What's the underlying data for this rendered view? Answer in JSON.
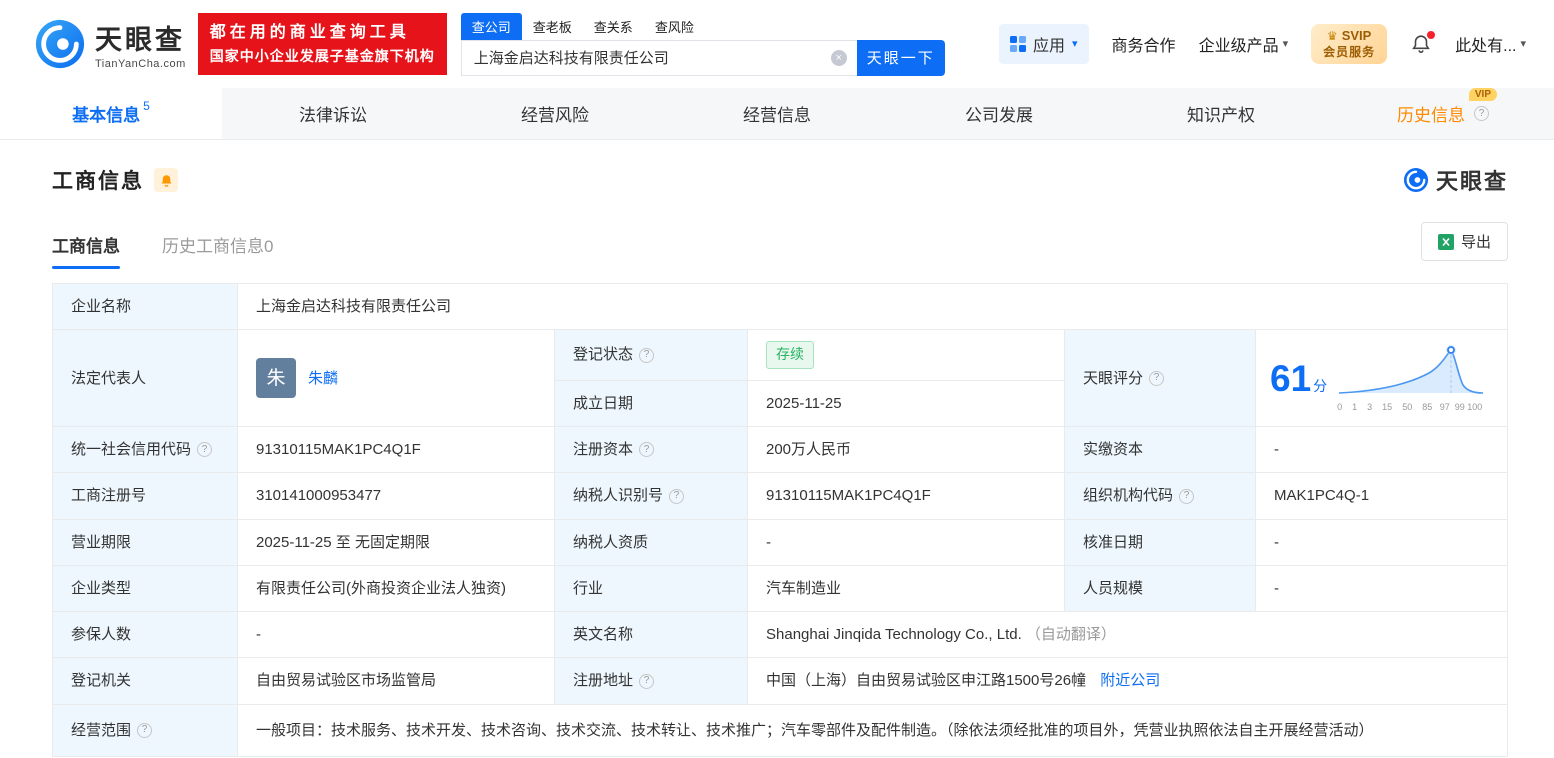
{
  "colors": {
    "accent": "#0d6ef5",
    "brand_red": "#e7131a",
    "status_green": "#28b361",
    "vip_orange": "#ff8a00",
    "label_bg": "#eef7fe"
  },
  "icons": {
    "help": "?",
    "clear": "×",
    "caret_down": "▾",
    "crown": "♛"
  },
  "header": {
    "logo": {
      "name": "天眼查",
      "domain": "TianYanCha.com"
    },
    "promo": {
      "line1": "都在用的商业查询工具",
      "line2": "国家中小企业发展子基金旗下机构"
    },
    "search": {
      "tabs": [
        {
          "label": "查公司"
        },
        {
          "label": "查老板"
        },
        {
          "label": "查关系"
        },
        {
          "label": "查风险"
        }
      ],
      "value": "上海金启达科技有限责任公司",
      "button": "天眼一下"
    },
    "nav": {
      "apps": "应用",
      "cooperation": "商务合作",
      "enterprise": "企业级产品",
      "svip_line1": "SVIP",
      "svip_line2": "会员服务",
      "more": "此处有..."
    }
  },
  "tabs": {
    "items": [
      {
        "label": "基本信息",
        "count": "5"
      },
      {
        "label": "法律诉讼"
      },
      {
        "label": "经营风险"
      },
      {
        "label": "经营信息"
      },
      {
        "label": "公司发展"
      },
      {
        "label": "知识产权"
      },
      {
        "label": "历史信息",
        "vip": "VIP"
      }
    ]
  },
  "section": {
    "title": "工商信息",
    "brand": "天眼查",
    "subtabs": [
      {
        "label": "工商信息"
      },
      {
        "label": "历史工商信息0"
      }
    ],
    "export_label": "导出"
  },
  "info": {
    "name": {
      "label": "企业名称",
      "value": "上海金启达科技有限责任公司"
    },
    "legal_rep": {
      "label": "法定代表人",
      "avatar": "朱",
      "value": "朱麟"
    },
    "reg_status": {
      "label": "登记状态",
      "value": "存续"
    },
    "est_date": {
      "label": "成立日期",
      "value": "2025-11-25"
    },
    "score": {
      "label": "天眼评分",
      "value": "61",
      "unit": "分",
      "axis": "0    1    3    15    50    85   97  99 100"
    },
    "credit_code": {
      "label": "统一社会信用代码",
      "value": "91310115MAK1PC4Q1F"
    },
    "reg_capital": {
      "label": "注册资本",
      "value": "200万人民币"
    },
    "paid_capital": {
      "label": "实缴资本",
      "value": "-"
    },
    "reg_number": {
      "label": "工商注册号",
      "value": "310141000953477"
    },
    "taxpayer_id": {
      "label": "纳税人识别号",
      "value": "91310115MAK1PC4Q1F"
    },
    "org_code": {
      "label": "组织机构代码",
      "value": "MAK1PC4Q-1"
    },
    "business_term": {
      "label": "营业期限",
      "value": "2025-11-25 至 无固定期限"
    },
    "taxpayer_qualification": {
      "label": "纳税人资质",
      "value": "-"
    },
    "approval_date": {
      "label": "核准日期",
      "value": "-"
    },
    "company_type": {
      "label": "企业类型",
      "value": "有限责任公司(外商投资企业法人独资)"
    },
    "industry": {
      "label": "行业",
      "value": "汽车制造业"
    },
    "staff_size": {
      "label": "人员规模",
      "value": "-"
    },
    "insured_count": {
      "label": "参保人数",
      "value": "-"
    },
    "english_name": {
      "label": "英文名称",
      "value": "Shanghai Jinqida Technology Co., Ltd.",
      "note": "（自动翻译）"
    },
    "reg_authority": {
      "label": "登记机关",
      "value": "自由贸易试验区市场监管局"
    },
    "reg_address": {
      "label": "注册地址",
      "value": "中国（上海）自由贸易试验区申江路1500号26幢",
      "link": "附近公司"
    },
    "business_scope": {
      "label": "经营范围",
      "value": "一般项目：技术服务、技术开发、技术咨询、技术交流、技术转让、技术推广；汽车零部件及配件制造。（除依法须经批准的项目外，凭营业执照依法自主开展经营活动）"
    }
  }
}
